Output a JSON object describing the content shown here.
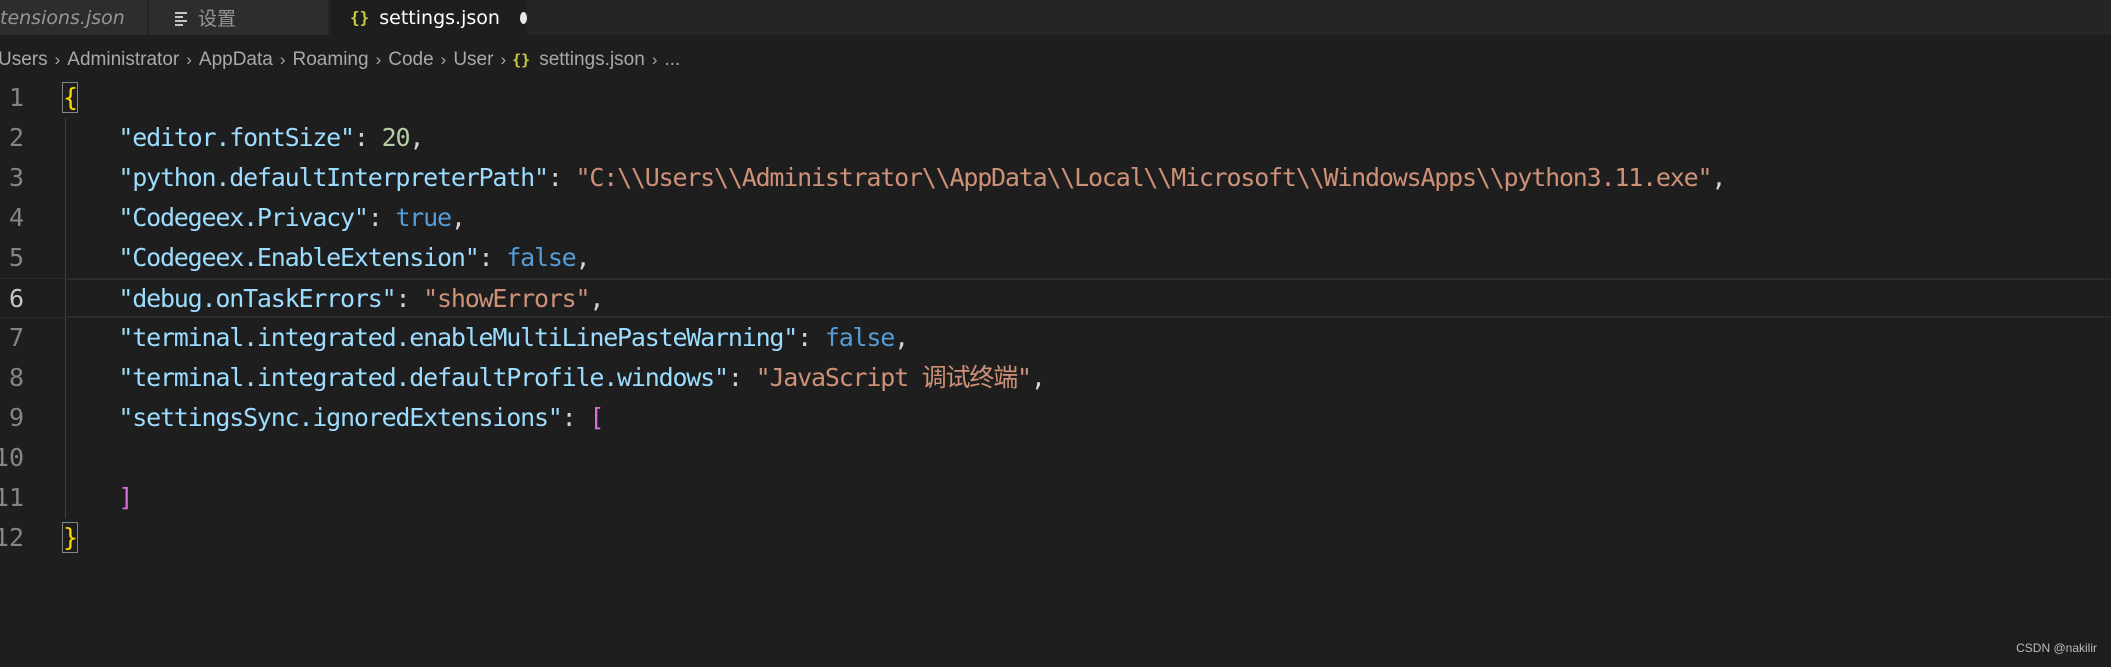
{
  "tabs": [
    {
      "label": "tensions.json",
      "icon": "json-file-icon",
      "active": false
    },
    {
      "label": "设置",
      "icon": "settings-editor-icon",
      "active": false
    },
    {
      "label": "settings.json",
      "icon": "json-braces-icon",
      "active": true,
      "dirty": true
    }
  ],
  "icons": {
    "json_braces_glyph": "{}",
    "breadcrumb_separator": "›"
  },
  "breadcrumb": {
    "segments": [
      "Users",
      "Administrator",
      "AppData",
      "Roaming",
      "Code",
      "User"
    ],
    "file": "settings.json",
    "ellipsis": "..."
  },
  "editor": {
    "active_line": 6,
    "lines": [
      {
        "num": "1",
        "text": "{"
      },
      {
        "num": "2",
        "text": "    \"editor.fontSize\": 20,"
      },
      {
        "num": "3",
        "text": "    \"python.defaultInterpreterPath\": \"C:\\\\Users\\\\Administrator\\\\AppData\\\\Local\\\\Microsoft\\\\WindowsApps\\\\python3.11.exe\","
      },
      {
        "num": "4",
        "text": "    \"Codegeex.Privacy\": true,"
      },
      {
        "num": "5",
        "text": "    \"Codegeex.EnableExtension\": false,"
      },
      {
        "num": "6",
        "text": "    \"debug.onTaskErrors\": \"showErrors\","
      },
      {
        "num": "7",
        "text": "    \"terminal.integrated.enableMultiLinePasteWarning\": false,"
      },
      {
        "num": "8",
        "text": "    \"terminal.integrated.defaultProfile.windows\": \"JavaScript 调试终端\","
      },
      {
        "num": "9",
        "text": "    \"settingsSync.ignoredExtensions\": ["
      },
      {
        "num": "10",
        "text": ""
      },
      {
        "num": "11",
        "text": "    ]"
      },
      {
        "num": "12",
        "text": "}"
      }
    ]
  },
  "colors": {
    "background": "#1e1e1e",
    "tab_bar": "#252526",
    "json_key": "#9cdcfe",
    "json_string": "#ce9178",
    "json_number": "#b5cea8",
    "json_keyword": "#569cd6",
    "brace": "#ffd700",
    "bracket": "#da70d6",
    "json_icon": "#cbcb41"
  },
  "watermark": "CSDN @nakilir"
}
